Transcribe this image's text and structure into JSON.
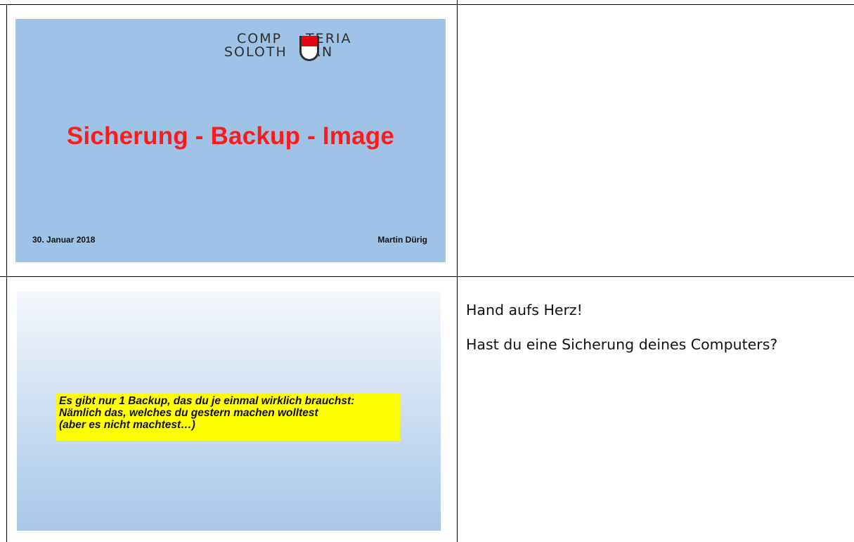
{
  "slide1": {
    "logo": {
      "line1": "COMPUTERIA",
      "line1_left": "COMP",
      "line1_right": "TERIA",
      "line2_left": "SOLOTH",
      "line2_right": "RN",
      "colors": {
        "shield_red": "#e30613",
        "shield_white": "#ffffff",
        "text": "#2d2d2d"
      }
    },
    "title": "Sicherung - Backup - Image",
    "date": "30. Januar 2018",
    "author": "Martin Dürig",
    "colors": {
      "background": "#9fc3e6",
      "title": "#ff1a1a"
    }
  },
  "slide2": {
    "quote_lines": [
      "Es gibt nur 1 Backup, das du je einmal wirklich brauchst:",
      "Nämlich das, welches du gestern machen wolltest",
      "(aber es nicht machtest…)"
    ],
    "colors": {
      "highlight": "#ffff00"
    }
  },
  "notes": {
    "paragraphs": [
      "Hand aufs Herz!",
      "Hast du eine Sicherung deines Computers?"
    ]
  }
}
